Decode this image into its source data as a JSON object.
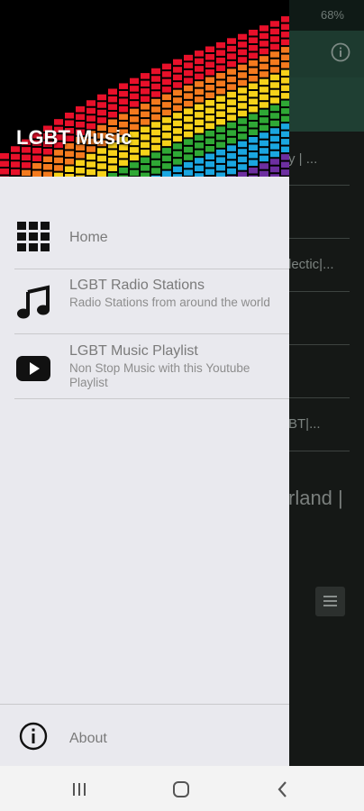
{
  "status_bar": {
    "battery": "68%"
  },
  "background_app": {
    "rows": [
      "y | ...",
      "lectic|...",
      "BT|..."
    ],
    "big_text": "rland |"
  },
  "drawer": {
    "header_title": "LGBT Music",
    "items": [
      {
        "icon": "grid-icon",
        "title": "Home"
      },
      {
        "icon": "music-note-icon",
        "title": "LGBT Radio Stations",
        "subtitle": "Radio Stations from around the world"
      },
      {
        "icon": "youtube-icon",
        "title": "LGBT Music Playlist",
        "subtitle": "Non Stop Music with this Youtube Playlist"
      }
    ],
    "about": {
      "icon": "info-icon",
      "label": "About"
    }
  },
  "nav_bar": {
    "buttons": [
      "recent-apps",
      "home",
      "back"
    ]
  },
  "colors": {
    "drawer_bg": "#e9e9ee",
    "header_bg": "#000000",
    "icon": "#111111"
  }
}
